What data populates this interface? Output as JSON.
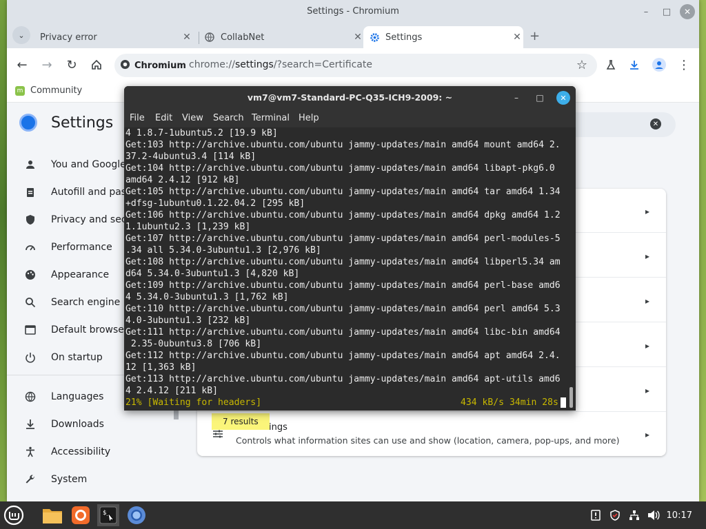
{
  "chrome": {
    "window_title": "Settings - Chromium",
    "tabs": [
      {
        "label": "Privacy error"
      },
      {
        "label": "CollabNet"
      },
      {
        "label": "Settings"
      }
    ],
    "omnibox": {
      "chip": "Chromium",
      "url_scheme": "chrome://",
      "url_path": "settings",
      "url_query": "/?search=Certificate"
    },
    "bookmarks": [
      {
        "label": "Community"
      }
    ],
    "settings": {
      "title": "Settings",
      "sidebar": [
        {
          "label": "You and Google",
          "icon": "person-icon"
        },
        {
          "label": "Autofill and pass",
          "icon": "clipboard-icon"
        },
        {
          "label": "Privacy and secu",
          "icon": "shield-icon"
        },
        {
          "label": "Performance",
          "icon": "gauge-icon"
        },
        {
          "label": "Appearance",
          "icon": "palette-icon"
        },
        {
          "label": "Search engine",
          "icon": "search-icon"
        },
        {
          "label": "Default browser",
          "icon": "browser-icon"
        },
        {
          "label": "On startup",
          "icon": "power-icon"
        },
        {
          "label": "Languages",
          "icon": "globe-icon"
        },
        {
          "label": "Downloads",
          "icon": "download-icon"
        },
        {
          "label": "Accessibility",
          "icon": "accessibility-icon"
        },
        {
          "label": "System",
          "icon": "wrench-icon"
        }
      ],
      "site_settings_title": "ings",
      "site_settings_sub": "Controls what information sites can use and show (location, camera, pop-ups, and more)",
      "results_bubble": "7 results"
    }
  },
  "terminal": {
    "title": "vm7@vm7-Standard-PC-Q35-ICH9-2009: ~",
    "menu": [
      "File",
      "Edit",
      "View",
      "Search",
      "Terminal",
      "Help"
    ],
    "lines": [
      "4 1.8.7-1ubuntu5.2 [19.9 kB]",
      "Get:103 http://archive.ubuntu.com/ubuntu jammy-updates/main amd64 mount amd64 2.",
      "37.2-4ubuntu3.4 [114 kB]",
      "Get:104 http://archive.ubuntu.com/ubuntu jammy-updates/main amd64 libapt-pkg6.0",
      "amd64 2.4.12 [912 kB]",
      "Get:105 http://archive.ubuntu.com/ubuntu jammy-updates/main amd64 tar amd64 1.34",
      "+dfsg-1ubuntu0.1.22.04.2 [295 kB]",
      "Get:106 http://archive.ubuntu.com/ubuntu jammy-updates/main amd64 dpkg amd64 1.2",
      "1.1ubuntu2.3 [1,239 kB]",
      "Get:107 http://archive.ubuntu.com/ubuntu jammy-updates/main amd64 perl-modules-5",
      ".34 all 5.34.0-3ubuntu1.3 [2,976 kB]",
      "Get:108 http://archive.ubuntu.com/ubuntu jammy-updates/main amd64 libperl5.34 am",
      "d64 5.34.0-3ubuntu1.3 [4,820 kB]",
      "Get:109 http://archive.ubuntu.com/ubuntu jammy-updates/main amd64 perl-base amd6",
      "4 5.34.0-3ubuntu1.3 [1,762 kB]",
      "Get:110 http://archive.ubuntu.com/ubuntu jammy-updates/main amd64 perl amd64 5.3",
      "4.0-3ubuntu1.3 [232 kB]",
      "Get:111 http://archive.ubuntu.com/ubuntu jammy-updates/main amd64 libc-bin amd64",
      " 2.35-0ubuntu3.8 [706 kB]",
      "Get:112 http://archive.ubuntu.com/ubuntu jammy-updates/main amd64 apt amd64 2.4.",
      "12 [1,363 kB]",
      "Get:113 http://archive.ubuntu.com/ubuntu jammy-updates/main amd64 apt-utils amd6",
      "4 2.4.12 [211 kB]"
    ],
    "status_left": "21% [Waiting for headers]",
    "status_right": "434 kB/s 34min 28s"
  },
  "taskbar": {
    "apps": [
      "mint-menu-icon",
      "files-icon",
      "firefox-icon",
      "terminal-icon",
      "chromium-icon"
    ],
    "clock": "10:17"
  }
}
